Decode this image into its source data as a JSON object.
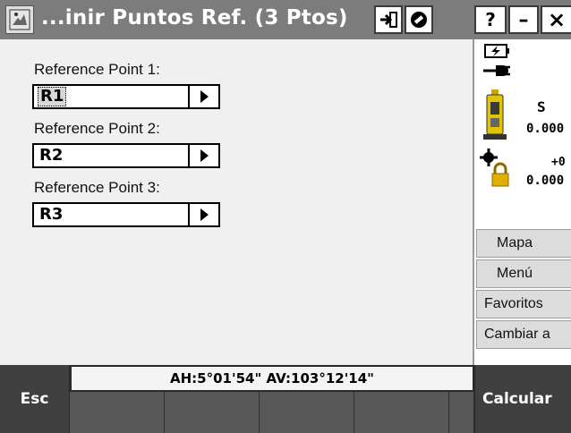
{
  "window": {
    "title": "...inir Puntos Ref. (3 Ptos)",
    "buttons": {
      "back_icon": "arrow-into-box-icon",
      "no_icon": "no-entry-icon",
      "help_label": "?",
      "minimize_label": "–",
      "close_label": "×"
    }
  },
  "form": {
    "fields": [
      {
        "label": "Reference Point 1:",
        "value": "R1",
        "selected": true
      },
      {
        "label": "Reference Point 2:",
        "value": "R2",
        "selected": false
      },
      {
        "label": "Reference Point 3:",
        "value": "R3",
        "selected": false
      }
    ]
  },
  "status": {
    "battery_icon": "battery-charging-icon",
    "power_icon": "power-plug-icon",
    "instrument_icon": "total-station-icon",
    "instrument_letter": "S",
    "instrument_value": "0.000",
    "target_icon": "prism-target-icon",
    "target_sign": "+0",
    "target_value": "0.000"
  },
  "menu": [
    "Mapa",
    "Menú",
    "Favoritos",
    "Cambiar a"
  ],
  "readout": "AH:5°01'54\"  AV:103°12'14\"",
  "softkeys": {
    "esc": "Esc",
    "calc": "Calcular"
  }
}
